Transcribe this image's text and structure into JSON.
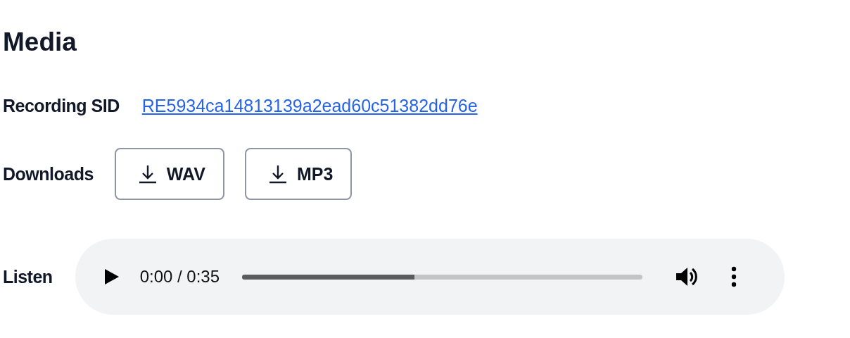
{
  "title": "Media",
  "recording": {
    "label": "Recording SID",
    "sid": "RE5934ca14813139a2ead60c51382dd76e"
  },
  "downloads": {
    "label": "Downloads",
    "buttons": [
      {
        "label": "WAV"
      },
      {
        "label": "MP3"
      }
    ]
  },
  "listen": {
    "label": "Listen",
    "time": "0:00 / 0:35",
    "level": 0.43
  }
}
